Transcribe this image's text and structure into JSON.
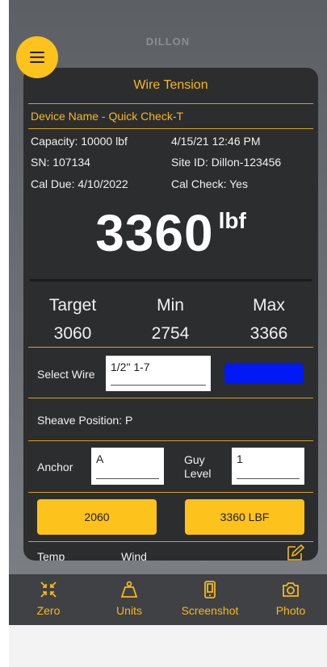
{
  "app": {
    "brand": "DILLON"
  },
  "card": {
    "title": "Wire Tension",
    "device_name": "Device Name  -  Quick Check-T",
    "info": {
      "capacity": "Capacity: 10000 lbf",
      "datetime": "4/15/21 12:46 PM",
      "sn": "SN: 107134",
      "site_id": "Site ID: Dillon-123456",
      "cal_due": "Cal Due:  4/10/2022",
      "cal_check": "Cal Check: Yes"
    },
    "reading": {
      "value": "3360",
      "unit": "lbf"
    },
    "stats": [
      {
        "label": "Target",
        "value": "3060"
      },
      {
        "label": "Min",
        "value": "2754"
      },
      {
        "label": "Max",
        "value": "3366"
      }
    ],
    "select_wire": {
      "label": "Select Wire",
      "value": "1/2\" 1-7",
      "color": "#0019f5"
    },
    "sheave_position": "Sheave Position:  P",
    "anchor": {
      "label": "Anchor",
      "value": "A"
    },
    "guy_level": {
      "label_line1": "Guy",
      "label_line2": "Level",
      "value": "1"
    },
    "buttons": {
      "left": "2060",
      "right": "3360 LBF"
    },
    "partial_labels": {
      "temp": "Temp",
      "wind": "Wind"
    }
  },
  "tabs": [
    {
      "label": "Zero",
      "icon": "zero-icon"
    },
    {
      "label": "Units",
      "icon": "weight-icon"
    },
    {
      "label": "Screenshot",
      "icon": "phone-icon"
    },
    {
      "label": "Photo",
      "icon": "camera-icon"
    }
  ],
  "colors": {
    "accent": "#fdc21b",
    "card_bg": "#2c2d2f",
    "tab_bg": "#3f4144"
  }
}
